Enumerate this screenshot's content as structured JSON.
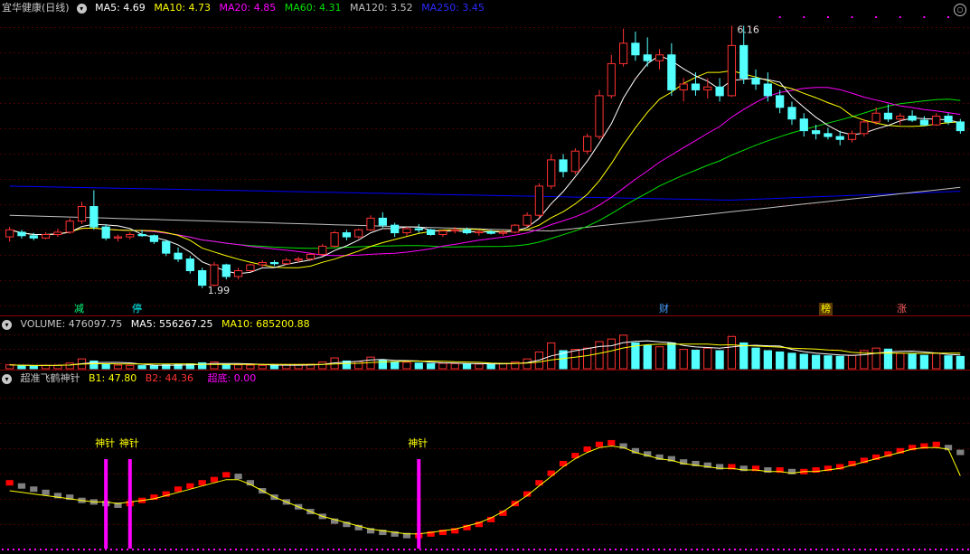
{
  "price_header": {
    "title": "宜华健康(日线)",
    "ma5": "MA5: 4.69",
    "ma10": "MA10: 4.73",
    "ma20": "MA20: 4.85",
    "ma60": "MA60: 4.31",
    "ma120": "MA120: 3.52",
    "ma250": "MA250: 3.45"
  },
  "volume_header": {
    "title": "VOLUME: 476097.75",
    "ma5": "MA5: 556267.25",
    "ma10": "MA10: 685200.88"
  },
  "indicator_header": {
    "title": "超准飞鹤神针",
    "b1": "B1: 47.80",
    "b2": "B2: 44.36",
    "chaodi": "超底: 0.00"
  },
  "markers": {
    "jian": "减",
    "ting": "停",
    "cai": "财",
    "bang": "榜",
    "zhang": "涨"
  },
  "signal_label": "神针",
  "colors": {
    "up": "#ff3232",
    "down": "#54ffff",
    "ma5": "#ffffff",
    "ma10": "#ffff00",
    "ma20": "#ff00ff",
    "ma60": "#00e000",
    "ma120": "#c0c0c0",
    "ma250": "#0000ff",
    "b1_up": "#ff0000",
    "b1_down": "#808080",
    "b2": "#ffff00",
    "signal": "#ff00ff"
  },
  "chart_data": {
    "type": "candlestick",
    "bars": 80,
    "price_range": [
      1.75,
      6.6
    ],
    "annotations": {
      "high": "6.16",
      "low": "1.99"
    },
    "candles": [
      [
        2.88,
        3.05,
        2.8,
        3.0
      ],
      [
        2.96,
        3.0,
        2.85,
        2.9
      ],
      [
        2.9,
        2.95,
        2.82,
        2.86
      ],
      [
        2.86,
        2.96,
        2.84,
        2.92
      ],
      [
        2.92,
        3.02,
        2.88,
        2.96
      ],
      [
        2.96,
        3.2,
        2.93,
        3.15
      ],
      [
        3.15,
        3.48,
        3.1,
        3.4
      ],
      [
        3.4,
        3.68,
        3.0,
        3.05
      ],
      [
        3.05,
        3.1,
        2.82,
        2.86
      ],
      [
        2.86,
        2.92,
        2.8,
        2.88
      ],
      [
        2.88,
        2.96,
        2.84,
        2.92
      ],
      [
        2.92,
        3.0,
        2.88,
        2.9
      ],
      [
        2.9,
        2.92,
        2.76,
        2.8
      ],
      [
        2.8,
        2.82,
        2.55,
        2.6
      ],
      [
        2.6,
        2.7,
        2.45,
        2.5
      ],
      [
        2.5,
        2.55,
        2.25,
        2.3
      ],
      [
        2.3,
        2.35,
        2.0,
        2.05
      ],
      [
        2.05,
        2.45,
        2.03,
        2.4
      ],
      [
        2.4,
        2.42,
        2.15,
        2.2
      ],
      [
        2.2,
        2.35,
        2.15,
        2.3
      ],
      [
        2.3,
        2.42,
        2.28,
        2.4
      ],
      [
        2.4,
        2.48,
        2.36,
        2.44
      ],
      [
        2.44,
        2.48,
        2.38,
        2.42
      ],
      [
        2.42,
        2.52,
        2.4,
        2.48
      ],
      [
        2.48,
        2.54,
        2.44,
        2.5
      ],
      [
        2.5,
        2.6,
        2.47,
        2.58
      ],
      [
        2.58,
        2.76,
        2.55,
        2.72
      ],
      [
        2.72,
        2.98,
        2.7,
        2.95
      ],
      [
        2.95,
        3.0,
        2.82,
        2.88
      ],
      [
        2.88,
        3.02,
        2.85,
        3.0
      ],
      [
        3.0,
        3.25,
        2.98,
        3.2
      ],
      [
        3.2,
        3.3,
        3.04,
        3.08
      ],
      [
        3.08,
        3.12,
        2.88,
        2.95
      ],
      [
        2.95,
        3.05,
        2.9,
        3.02
      ],
      [
        3.02,
        3.1,
        2.95,
        3.0
      ],
      [
        3.0,
        3.02,
        2.9,
        2.92
      ],
      [
        2.92,
        3.0,
        2.88,
        2.98
      ],
      [
        2.98,
        3.05,
        2.94,
        3.0
      ],
      [
        3.0,
        3.04,
        2.92,
        2.95
      ],
      [
        2.95,
        3.0,
        2.9,
        2.97
      ],
      [
        2.97,
        3.0,
        2.92,
        2.94
      ],
      [
        2.94,
        3.0,
        2.9,
        2.96
      ],
      [
        2.96,
        3.1,
        2.94,
        3.08
      ],
      [
        3.08,
        3.3,
        3.05,
        3.25
      ],
      [
        3.25,
        3.8,
        3.2,
        3.75
      ],
      [
        3.75,
        4.3,
        3.7,
        4.2
      ],
      [
        4.2,
        4.3,
        3.9,
        4.0
      ],
      [
        4.0,
        4.4,
        3.95,
        4.35
      ],
      [
        4.35,
        4.65,
        4.3,
        4.6
      ],
      [
        4.6,
        5.4,
        4.55,
        5.3
      ],
      [
        5.3,
        6.0,
        5.25,
        5.85
      ],
      [
        5.85,
        6.45,
        5.8,
        6.2
      ],
      [
        6.2,
        6.4,
        5.9,
        6.0
      ],
      [
        6.0,
        6.3,
        5.8,
        5.9
      ],
      [
        5.9,
        6.1,
        5.75,
        6.0
      ],
      [
        6.0,
        6.2,
        5.3,
        5.4
      ],
      [
        5.4,
        5.6,
        5.2,
        5.5
      ],
      [
        5.5,
        5.7,
        5.3,
        5.4
      ],
      [
        5.4,
        5.6,
        5.25,
        5.45
      ],
      [
        5.45,
        5.6,
        5.2,
        5.3
      ],
      [
        5.3,
        6.5,
        5.28,
        6.16
      ],
      [
        6.16,
        6.5,
        5.5,
        5.6
      ],
      [
        5.6,
        5.75,
        5.4,
        5.5
      ],
      [
        5.5,
        5.7,
        5.2,
        5.3
      ],
      [
        5.3,
        5.4,
        5.0,
        5.1
      ],
      [
        5.1,
        5.2,
        4.8,
        4.9
      ],
      [
        4.9,
        5.0,
        4.6,
        4.7
      ],
      [
        4.7,
        4.8,
        4.55,
        4.65
      ],
      [
        4.65,
        4.75,
        4.55,
        4.6
      ],
      [
        4.6,
        4.7,
        4.45,
        4.55
      ],
      [
        4.55,
        4.7,
        4.5,
        4.65
      ],
      [
        4.65,
        4.9,
        4.6,
        4.85
      ],
      [
        4.85,
        5.1,
        4.8,
        5.0
      ],
      [
        5.0,
        5.15,
        4.85,
        4.9
      ],
      [
        4.9,
        5.0,
        4.8,
        4.95
      ],
      [
        4.95,
        5.05,
        4.85,
        4.88
      ],
      [
        4.88,
        4.95,
        4.78,
        4.8
      ],
      [
        4.8,
        5.0,
        4.78,
        4.95
      ],
      [
        4.95,
        5.0,
        4.8,
        4.85
      ],
      [
        4.85,
        4.9,
        4.65,
        4.7
      ]
    ],
    "volume_range": [
      0,
      1400000
    ],
    "volume": [
      150000,
      120000,
      110000,
      130000,
      140000,
      220000,
      380000,
      300000,
      180000,
      140000,
      130000,
      120000,
      110000,
      150000,
      170000,
      190000,
      230000,
      260000,
      160000,
      150000,
      140000,
      130000,
      120000,
      140000,
      150000,
      170000,
      260000,
      420000,
      300000,
      280000,
      450000,
      330000,
      260000,
      250000,
      220000,
      200000,
      210000,
      200000,
      190000,
      180000,
      170000,
      200000,
      260000,
      380000,
      650000,
      1000000,
      700000,
      750000,
      800000,
      1050000,
      1150000,
      1300000,
      1000000,
      900000,
      850000,
      1000000,
      750000,
      720000,
      800000,
      700000,
      1250000,
      1000000,
      800000,
      700000,
      650000,
      600000,
      560000,
      520000,
      500000,
      480000,
      520000,
      700000,
      800000,
      760000,
      600000,
      560000,
      520000,
      600000,
      500000,
      476098
    ],
    "indicator_range": [
      0,
      100
    ],
    "b1": [
      40,
      38,
      36,
      34,
      32,
      31,
      29,
      28,
      27,
      26,
      27,
      29,
      31,
      33,
      36,
      38,
      40,
      42,
      45,
      44,
      40,
      35,
      31,
      28,
      25,
      22,
      19,
      16,
      14,
      12,
      10,
      9,
      8,
      7,
      7,
      8,
      9,
      10,
      12,
      14,
      17,
      21,
      27,
      33,
      40,
      46,
      52,
      57,
      61,
      64,
      65,
      63,
      60,
      58,
      56,
      55,
      53,
      52,
      51,
      50,
      50,
      49,
      49,
      48,
      48,
      47,
      47,
      48,
      49,
      50,
      52,
      54,
      56,
      58,
      60,
      62,
      63,
      64,
      62,
      59
    ],
    "b2": [
      35,
      34,
      33,
      32,
      31,
      30,
      29,
      28,
      28,
      27,
      28,
      29,
      30,
      32,
      34,
      36,
      38,
      40,
      42,
      42,
      39,
      35,
      31,
      28,
      25,
      22,
      19,
      17,
      15,
      13,
      11,
      10,
      9,
      8,
      8,
      9,
      10,
      11,
      13,
      15,
      18,
      22,
      27,
      32,
      38,
      44,
      50,
      55,
      59,
      62,
      63,
      62,
      59,
      57,
      55,
      54,
      52,
      51,
      50,
      49,
      49,
      48,
      48,
      47,
      47,
      46,
      47,
      47,
      48,
      49,
      51,
      53,
      55,
      57,
      59,
      61,
      62,
      62,
      61,
      44.36
    ],
    "signals": [
      8,
      10,
      34
    ]
  }
}
